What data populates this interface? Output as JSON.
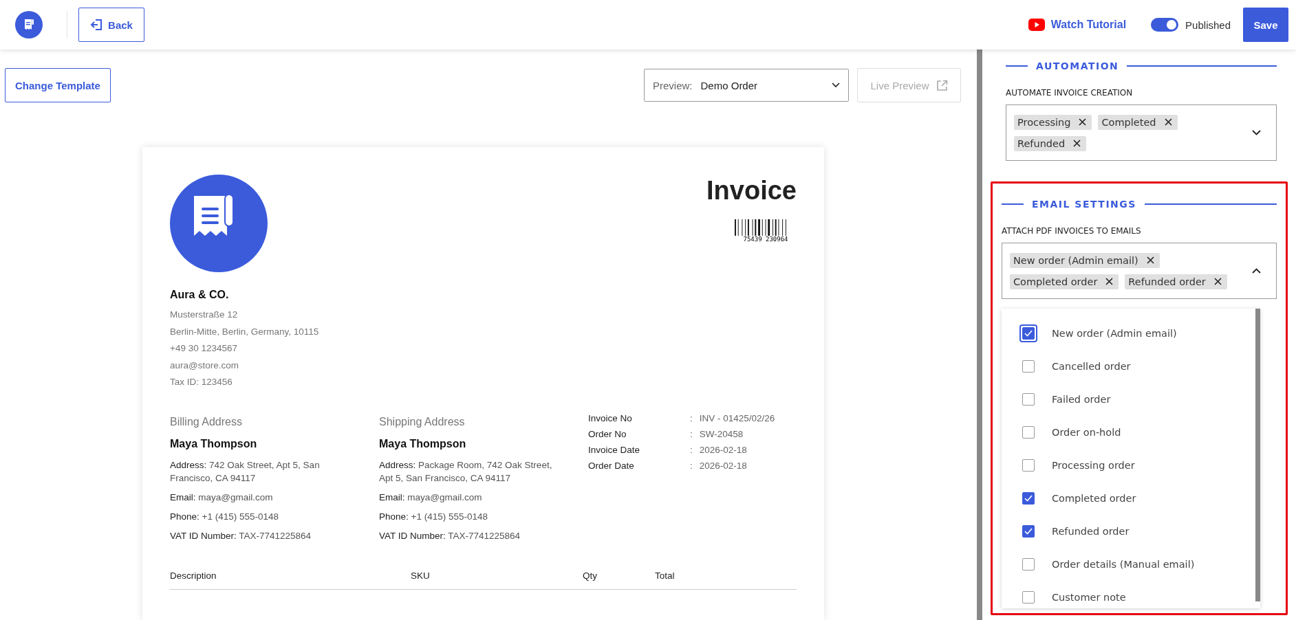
{
  "header": {
    "back_label": "Back",
    "tutorial_label": "Watch Tutorial",
    "published": {
      "label": "Published",
      "on": true
    },
    "save_label": "Save"
  },
  "toolbar": {
    "change_template_label": "Change Template",
    "preview": {
      "label": "Preview:",
      "value": "Demo Order"
    },
    "live_preview": {
      "label": "Live Preview",
      "disabled": true
    }
  },
  "invoice": {
    "title": "Invoice",
    "barcode_number": "75439 230964",
    "company": {
      "name": "Aura & CO.",
      "lines": [
        "Musterstraße 12",
        "Berlin-Mitte, Berlin, Germany, 10115",
        "+49 30 1234567",
        "aura@store.com",
        "Tax ID: 123456"
      ]
    },
    "addresses": [
      {
        "heading": "Billing Address",
        "name": "Maya Thompson",
        "fields": [
          {
            "label": "Address:",
            "value": "742 Oak Street, Apt 5, San Francisco, CA 94117"
          },
          {
            "label": "Email:",
            "value": "maya@gmail.com"
          },
          {
            "label": "Phone:",
            "value": "+1 (415) 555-0148"
          },
          {
            "label": "VAT ID Number:",
            "value": "TAX-7741225864"
          }
        ]
      },
      {
        "heading": "Shipping Address",
        "name": "Maya Thompson",
        "fields": [
          {
            "label": "Address:",
            "value": "Package Room, 742 Oak Street, Apt 5, San Francisco, CA 94117"
          },
          {
            "label": "Email:",
            "value": "maya@gmail.com"
          },
          {
            "label": "Phone:",
            "value": "+1 (415) 555-0148"
          },
          {
            "label": "VAT ID Number:",
            "value": "TAX-7741225864"
          }
        ]
      }
    ],
    "meta": [
      {
        "label": "Invoice No",
        "separator": ":",
        "value": "INV - 01425/02/26"
      },
      {
        "label": "Order No",
        "separator": ":",
        "value": "SW-20458"
      },
      {
        "label": "Invoice Date",
        "separator": ":",
        "value": "2026-02-18"
      },
      {
        "label": "Order Date",
        "separator": ":",
        "value": "2026-02-18"
      }
    ],
    "table": {
      "columns": [
        "Description",
        "SKU",
        "Qty",
        "Total"
      ]
    }
  },
  "settings": {
    "automation": {
      "heading": "AUTOMATION",
      "label": "AUTOMATE INVOICE CREATION",
      "tags": [
        "Processing",
        "Completed",
        "Refunded"
      ],
      "expanded": false
    },
    "email": {
      "heading": "EMAIL SETTINGS",
      "label": "ATTACH PDF INVOICES TO EMAILS",
      "tags": [
        "New order (Admin email)",
        "Completed order",
        "Refunded order"
      ],
      "expanded": true,
      "options": [
        {
          "label": "New order (Admin email)",
          "checked": true,
          "focused": true
        },
        {
          "label": "Cancelled order",
          "checked": false
        },
        {
          "label": "Failed order",
          "checked": false
        },
        {
          "label": "Order on-hold",
          "checked": false
        },
        {
          "label": "Processing order",
          "checked": false
        },
        {
          "label": "Completed order",
          "checked": true
        },
        {
          "label": "Refunded order",
          "checked": true
        },
        {
          "label": "Order details (Manual email)",
          "checked": false
        },
        {
          "label": "Customer note",
          "checked": false
        }
      ]
    }
  }
}
